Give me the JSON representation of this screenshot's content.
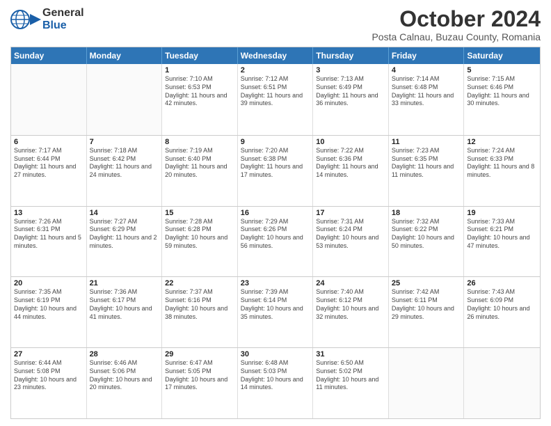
{
  "logo": {
    "line1": "General",
    "line2": "Blue"
  },
  "header": {
    "month": "October 2024",
    "location": "Posta Calnau, Buzau County, Romania"
  },
  "days": [
    "Sunday",
    "Monday",
    "Tuesday",
    "Wednesday",
    "Thursday",
    "Friday",
    "Saturday"
  ],
  "rows": [
    [
      {
        "day": "",
        "info": ""
      },
      {
        "day": "",
        "info": ""
      },
      {
        "day": "1",
        "info": "Sunrise: 7:10 AM\nSunset: 6:53 PM\nDaylight: 11 hours and 42 minutes."
      },
      {
        "day": "2",
        "info": "Sunrise: 7:12 AM\nSunset: 6:51 PM\nDaylight: 11 hours and 39 minutes."
      },
      {
        "day": "3",
        "info": "Sunrise: 7:13 AM\nSunset: 6:49 PM\nDaylight: 11 hours and 36 minutes."
      },
      {
        "day": "4",
        "info": "Sunrise: 7:14 AM\nSunset: 6:48 PM\nDaylight: 11 hours and 33 minutes."
      },
      {
        "day": "5",
        "info": "Sunrise: 7:15 AM\nSunset: 6:46 PM\nDaylight: 11 hours and 30 minutes."
      }
    ],
    [
      {
        "day": "6",
        "info": "Sunrise: 7:17 AM\nSunset: 6:44 PM\nDaylight: 11 hours and 27 minutes."
      },
      {
        "day": "7",
        "info": "Sunrise: 7:18 AM\nSunset: 6:42 PM\nDaylight: 11 hours and 24 minutes."
      },
      {
        "day": "8",
        "info": "Sunrise: 7:19 AM\nSunset: 6:40 PM\nDaylight: 11 hours and 20 minutes."
      },
      {
        "day": "9",
        "info": "Sunrise: 7:20 AM\nSunset: 6:38 PM\nDaylight: 11 hours and 17 minutes."
      },
      {
        "day": "10",
        "info": "Sunrise: 7:22 AM\nSunset: 6:36 PM\nDaylight: 11 hours and 14 minutes."
      },
      {
        "day": "11",
        "info": "Sunrise: 7:23 AM\nSunset: 6:35 PM\nDaylight: 11 hours and 11 minutes."
      },
      {
        "day": "12",
        "info": "Sunrise: 7:24 AM\nSunset: 6:33 PM\nDaylight: 11 hours and 8 minutes."
      }
    ],
    [
      {
        "day": "13",
        "info": "Sunrise: 7:26 AM\nSunset: 6:31 PM\nDaylight: 11 hours and 5 minutes."
      },
      {
        "day": "14",
        "info": "Sunrise: 7:27 AM\nSunset: 6:29 PM\nDaylight: 11 hours and 2 minutes."
      },
      {
        "day": "15",
        "info": "Sunrise: 7:28 AM\nSunset: 6:28 PM\nDaylight: 10 hours and 59 minutes."
      },
      {
        "day": "16",
        "info": "Sunrise: 7:29 AM\nSunset: 6:26 PM\nDaylight: 10 hours and 56 minutes."
      },
      {
        "day": "17",
        "info": "Sunrise: 7:31 AM\nSunset: 6:24 PM\nDaylight: 10 hours and 53 minutes."
      },
      {
        "day": "18",
        "info": "Sunrise: 7:32 AM\nSunset: 6:22 PM\nDaylight: 10 hours and 50 minutes."
      },
      {
        "day": "19",
        "info": "Sunrise: 7:33 AM\nSunset: 6:21 PM\nDaylight: 10 hours and 47 minutes."
      }
    ],
    [
      {
        "day": "20",
        "info": "Sunrise: 7:35 AM\nSunset: 6:19 PM\nDaylight: 10 hours and 44 minutes."
      },
      {
        "day": "21",
        "info": "Sunrise: 7:36 AM\nSunset: 6:17 PM\nDaylight: 10 hours and 41 minutes."
      },
      {
        "day": "22",
        "info": "Sunrise: 7:37 AM\nSunset: 6:16 PM\nDaylight: 10 hours and 38 minutes."
      },
      {
        "day": "23",
        "info": "Sunrise: 7:39 AM\nSunset: 6:14 PM\nDaylight: 10 hours and 35 minutes."
      },
      {
        "day": "24",
        "info": "Sunrise: 7:40 AM\nSunset: 6:12 PM\nDaylight: 10 hours and 32 minutes."
      },
      {
        "day": "25",
        "info": "Sunrise: 7:42 AM\nSunset: 6:11 PM\nDaylight: 10 hours and 29 minutes."
      },
      {
        "day": "26",
        "info": "Sunrise: 7:43 AM\nSunset: 6:09 PM\nDaylight: 10 hours and 26 minutes."
      }
    ],
    [
      {
        "day": "27",
        "info": "Sunrise: 6:44 AM\nSunset: 5:08 PM\nDaylight: 10 hours and 23 minutes."
      },
      {
        "day": "28",
        "info": "Sunrise: 6:46 AM\nSunset: 5:06 PM\nDaylight: 10 hours and 20 minutes."
      },
      {
        "day": "29",
        "info": "Sunrise: 6:47 AM\nSunset: 5:05 PM\nDaylight: 10 hours and 17 minutes."
      },
      {
        "day": "30",
        "info": "Sunrise: 6:48 AM\nSunset: 5:03 PM\nDaylight: 10 hours and 14 minutes."
      },
      {
        "day": "31",
        "info": "Sunrise: 6:50 AM\nSunset: 5:02 PM\nDaylight: 10 hours and 11 minutes."
      },
      {
        "day": "",
        "info": ""
      },
      {
        "day": "",
        "info": ""
      }
    ]
  ]
}
